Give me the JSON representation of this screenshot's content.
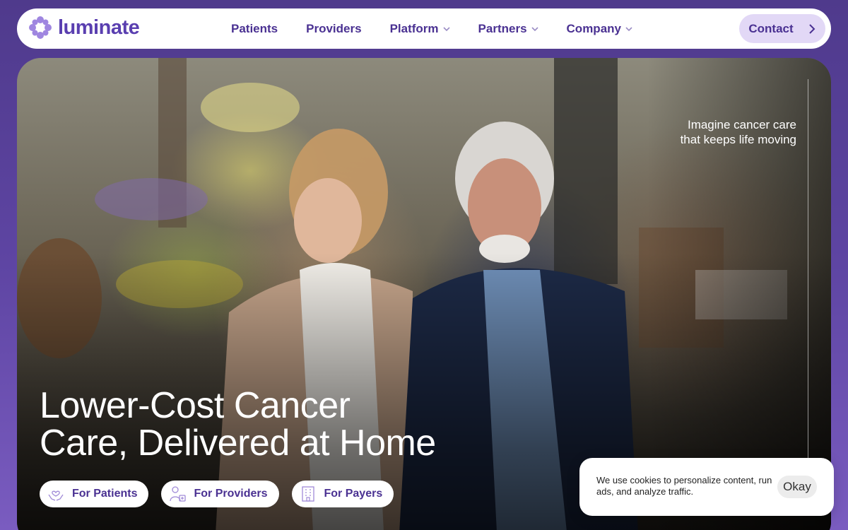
{
  "brand": {
    "name": "luminate",
    "accent": "#5a3fb0",
    "nav_text_color": "#4a3192"
  },
  "nav": {
    "items": [
      {
        "label": "Patients",
        "dropdown": false
      },
      {
        "label": "Providers",
        "dropdown": false
      },
      {
        "label": "Platform",
        "dropdown": true
      },
      {
        "label": "Partners",
        "dropdown": true
      },
      {
        "label": "Company",
        "dropdown": true
      }
    ],
    "contact_label": "Contact"
  },
  "hero": {
    "tagline_line1": "Imagine cancer care",
    "tagline_line2": "that keeps life moving",
    "headline_line1": "Lower-Cost Cancer",
    "headline_line2": "Care, Delivered at Home",
    "pills": [
      {
        "label": "For Patients",
        "icon": "hands-heart-icon"
      },
      {
        "label": "For Providers",
        "icon": "doctor-icon"
      },
      {
        "label": "For Payers",
        "icon": "building-icon"
      }
    ]
  },
  "cookie": {
    "message": "We use cookies to personalize content, run ads, and analyze traffic.",
    "button_label": "Okay"
  }
}
